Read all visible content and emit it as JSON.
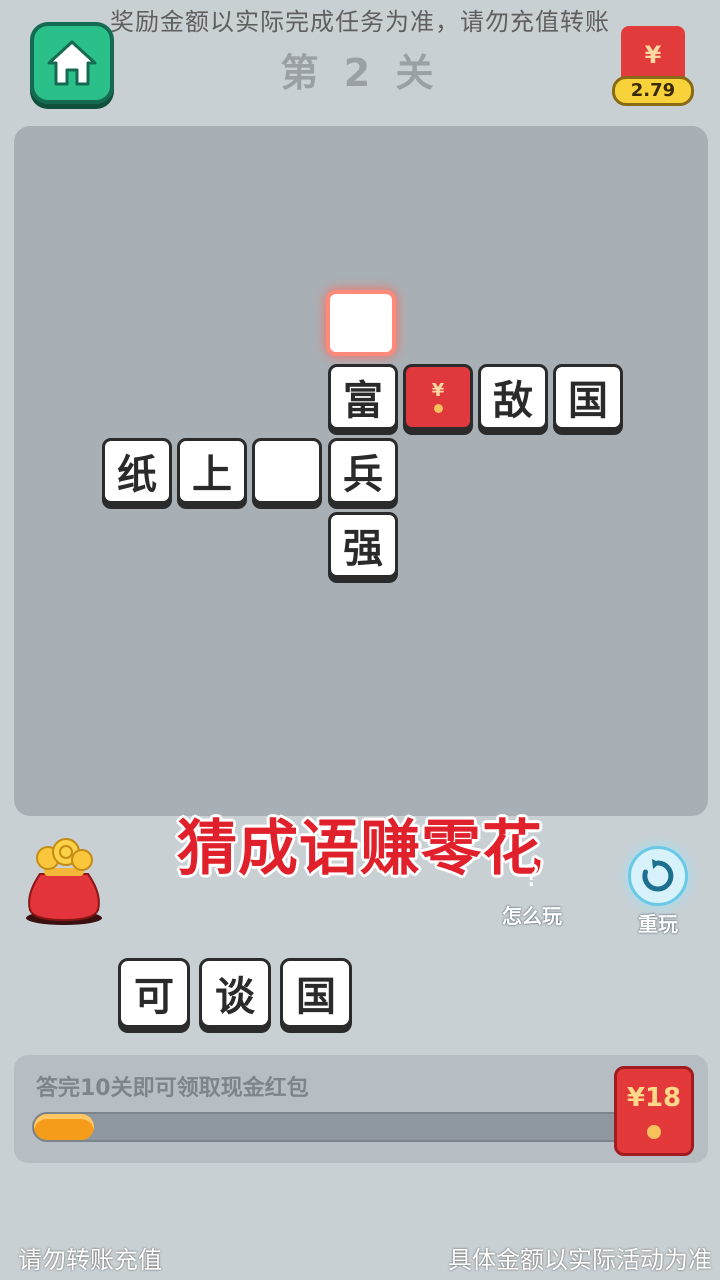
{
  "header": {
    "notice": "奖励金额以实际完成任务为准，请勿充值转账",
    "level_title": "第 2 关",
    "balance": "2.79",
    "balance_symbol": "¥"
  },
  "board": {
    "tiles": {
      "fu": "富",
      "di": "敌",
      "guo": "国",
      "zhi": "纸",
      "shang": "上",
      "bing": "兵",
      "qiang": "强"
    },
    "red_tile_symbol": "¥"
  },
  "slogan": "猜成语赚零花",
  "actions": {
    "howto_label": "怎么玩",
    "howto_symbol": "?",
    "replay_label": "重玩"
  },
  "choices": [
    "可",
    "谈",
    "国"
  ],
  "progress": {
    "label": "答完10关即可领取现金红包",
    "fraction": 0.1,
    "reward": "¥18"
  },
  "footer": {
    "left": "请勿转账充值",
    "right": "具体金额以实际活动为准"
  },
  "colors": {
    "accent_green": "#2bbf8a",
    "brand_red": "#e0202a",
    "progress_orange": "#f59c1a"
  }
}
